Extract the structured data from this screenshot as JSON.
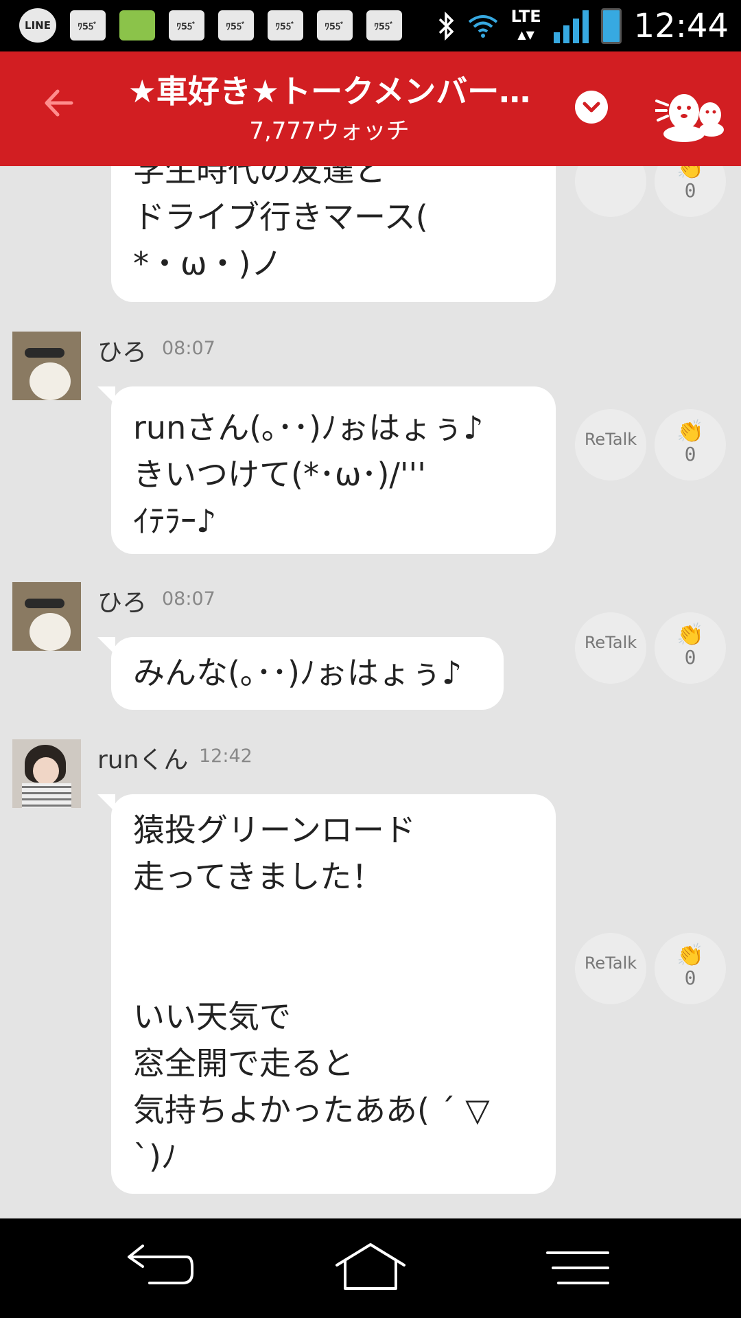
{
  "status_bar": {
    "line_icon_label": "LINE",
    "notification_labels": [
      "ﾜ55ﾞ",
      "ﾜ55ﾞ",
      "ﾜ55ﾞ",
      "ﾜ55ﾞ",
      "ﾜ55ﾞ",
      "ﾜ55ﾞ"
    ],
    "network_label": "LTE",
    "time": "12:44"
  },
  "header": {
    "title": "★車好き★トークメンバー…",
    "subtitle": "7,777ウォッチ"
  },
  "messages": [
    {
      "text": "学生時代の友達と\nドライブ行きマース(\n*・ω・)ノ",
      "clap_count": "0"
    },
    {
      "name": "ひろ",
      "time": "08:07",
      "text": "runさん(｡･･)ﾉぉはょぅ♪\nきいつけて(*･ω･)/'''\nｲﾃﾗｰ♪",
      "retalk_label": "ReTalk",
      "clap_count": "0"
    },
    {
      "name": "ひろ",
      "time": "08:07",
      "text": "みんな(｡･･)ﾉぉはょぅ♪",
      "retalk_label": "ReTalk",
      "clap_count": "0"
    },
    {
      "name": "runくん",
      "time": "12:42",
      "text": "猿投グリーンロード\n走ってきました！\n\n\nいい天気で\n窓全開で走ると\n気持ちよかったああ( ´ ▽\n`)ﾉ",
      "retalk_label": "ReTalk",
      "clap_count": "0"
    }
  ],
  "colors": {
    "header_bg": "#d21e22",
    "feed_bg": "#e4e4e4",
    "bubble_bg": "#ffffff"
  },
  "icons": {
    "back": "arrow-left-icon",
    "dropdown": "chevron-down-icon",
    "mascot": "mascot-icon",
    "clap": "clap-icon",
    "nav_back": "nav-back-icon",
    "nav_home": "nav-home-icon",
    "nav_menu": "nav-menu-icon"
  }
}
